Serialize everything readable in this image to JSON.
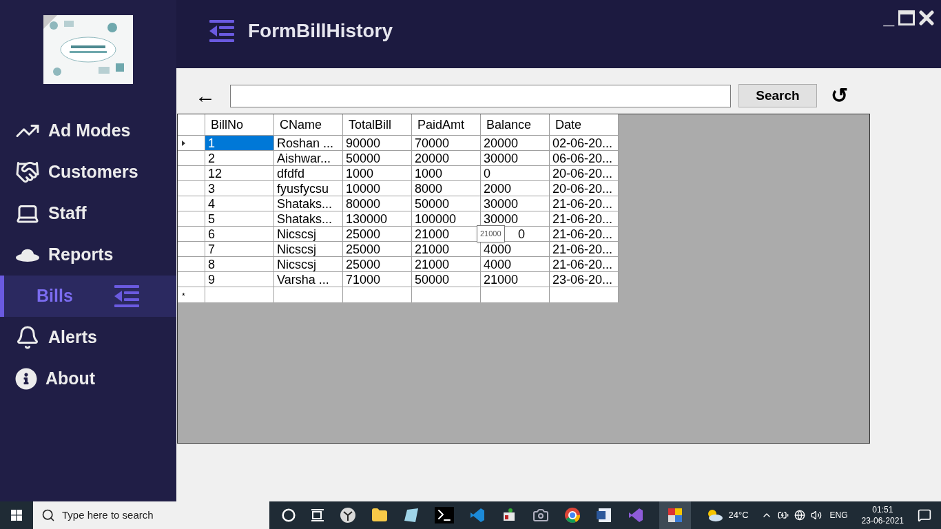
{
  "window": {
    "title": "FormBillHistory",
    "controls": [
      "_"
    ]
  },
  "sidebar": {
    "items": [
      {
        "label": "Ad Modes",
        "kind": "chart",
        "selected": false
      },
      {
        "label": "Customers",
        "kind": "handshake",
        "selected": false
      },
      {
        "label": "Staff",
        "kind": "laptop",
        "selected": false
      },
      {
        "label": "Reports",
        "kind": "hat",
        "selected": false
      },
      {
        "label": "Bills",
        "kind": "none",
        "selected": true
      },
      {
        "label": "Alerts",
        "kind": "bell",
        "selected": false
      },
      {
        "label": "About",
        "kind": "info",
        "selected": false
      }
    ]
  },
  "toolbar": {
    "back": "←",
    "search_button": "Search",
    "refresh": "↺"
  },
  "table": {
    "columns": [
      "BillNo",
      "CName",
      "TotalBill",
      "PaidAmt",
      "Balance",
      "Date"
    ],
    "new_row_marker": "*",
    "rows": [
      {
        "cells": [
          "1",
          "Roshan ...",
          "90000",
          "70000",
          "20000",
          "02-06-20..."
        ],
        "selected": true
      },
      {
        "cells": [
          "2",
          "Aishwar...",
          "50000",
          "20000",
          "30000",
          "06-06-20..."
        ],
        "selected": false
      },
      {
        "cells": [
          "12",
          "dfdfd",
          "1000",
          "1000",
          "0",
          "20-06-20..."
        ],
        "selected": false
      },
      {
        "cells": [
          "3",
          "fyusfycsu",
          "10000",
          "8000",
          "2000",
          "20-06-20..."
        ],
        "selected": false
      },
      {
        "cells": [
          "4",
          "Shataks...",
          "80000",
          "50000",
          "30000",
          "21-06-20..."
        ],
        "selected": false
      },
      {
        "cells": [
          "5",
          "Shataks...",
          "130000",
          "100000",
          "30000",
          "21-06-20..."
        ],
        "selected": false
      },
      {
        "cells": [
          "6",
          "Nicscsj",
          "25000",
          "21000",
          "0",
          "21-06-20..."
        ],
        "selected": false,
        "tooltip": "21000"
      },
      {
        "cells": [
          "7",
          "Nicscsj",
          "25000",
          "21000",
          "4000",
          "21-06-20..."
        ],
        "selected": false
      },
      {
        "cells": [
          "8",
          "Nicscsj",
          "25000",
          "21000",
          "4000",
          "21-06-20..."
        ],
        "selected": false
      },
      {
        "cells": [
          "9",
          "Varsha ...",
          "71000",
          "50000",
          "21000",
          "23-06-20..."
        ],
        "selected": false
      }
    ]
  },
  "taskbar": {
    "search_placeholder": "Type here to search",
    "temperature": "24°C",
    "language": "ENG",
    "time": "01:51",
    "date": "23-06-2021"
  }
}
